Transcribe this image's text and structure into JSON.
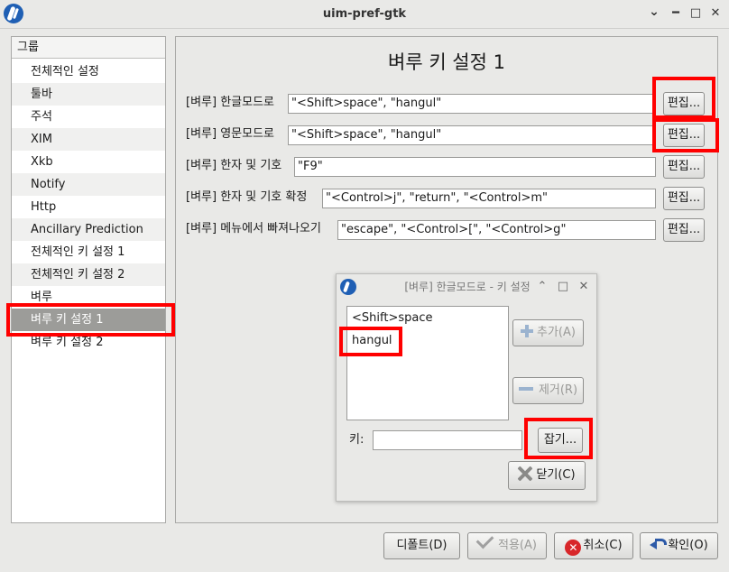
{
  "window": {
    "title": "uim-pref-gtk"
  },
  "sidebar": {
    "header": "그룹",
    "items": [
      "전체적인 설정",
      "툴바",
      "주석",
      "XIM",
      "Xkb",
      "Notify",
      "Http",
      "Ancillary Prediction",
      "전체적인 키 설정 1",
      "전체적인 키 설정 2",
      "벼루",
      "벼루 키 설정 1",
      "벼루 키 설정 2"
    ]
  },
  "panel": {
    "heading": "벼루 키 설정 1",
    "rows": [
      {
        "label": "[벼루] 한글모드로",
        "value": "\"<Shift>space\", \"hangul\"",
        "button": "편집..."
      },
      {
        "label": "[벼루] 영문모드로",
        "value": "\"<Shift>space\", \"hangul\"",
        "button": "편집..."
      },
      {
        "label": "[벼루] 한자 및 기호",
        "value": "\"F9\"",
        "button": "편집..."
      },
      {
        "label": "[벼루] 한자 및 기호 확정",
        "value": "\"<Control>j\", \"return\", \"<Control>m\"",
        "button": "편집..."
      },
      {
        "label": "[벼루] 메뉴에서 빠져나오기",
        "value": "\"escape\", \"<Control>[\", \"<Control>g\"",
        "button": "편집..."
      }
    ]
  },
  "dialog": {
    "title": "[벼루] 한글모드로 - 키 설정",
    "keys": [
      "<Shift>space",
      "hangul"
    ],
    "add_label": "추가(A)",
    "remove_label": "제거(R)",
    "key_label": "키:",
    "key_value": "",
    "capture_label": "잡기...",
    "close_label": "닫기(C)"
  },
  "footer": {
    "default_label": "디폴트(D)",
    "apply_label": "적용(A)",
    "cancel_label": "취소(C)",
    "ok_label": "확인(O)"
  },
  "colors": {
    "highlight": "#ff0000",
    "selection": "#9c9c99"
  }
}
